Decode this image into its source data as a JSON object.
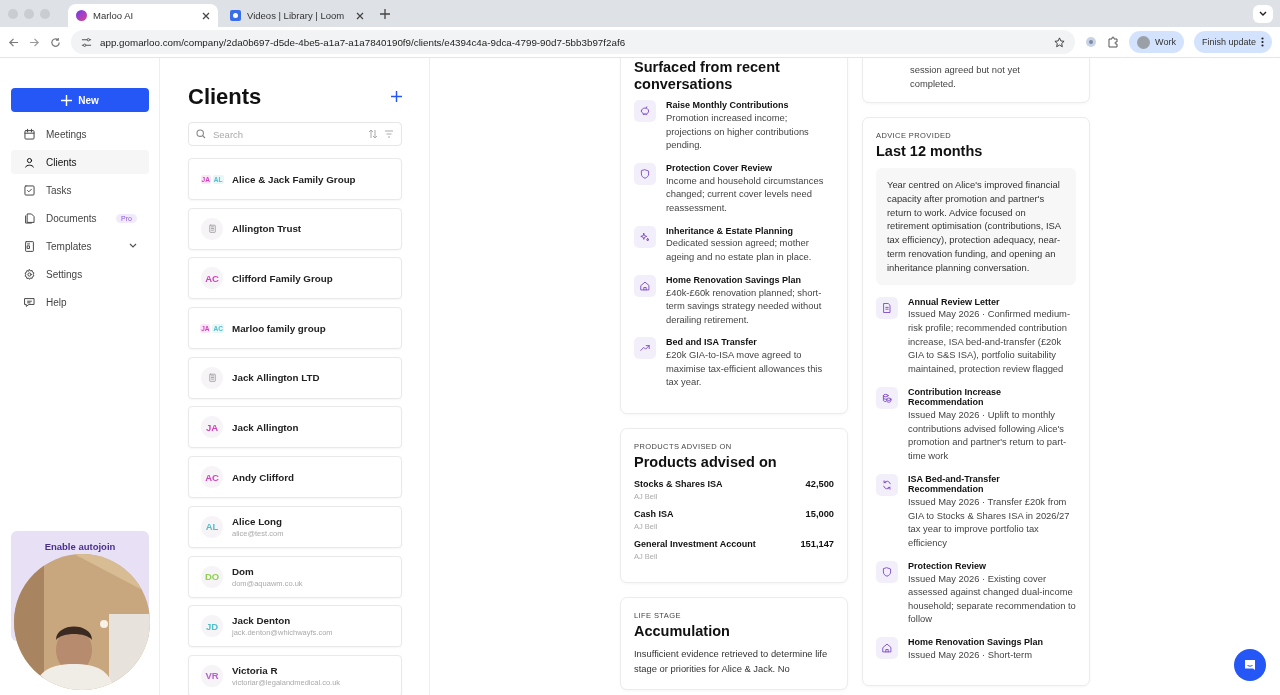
{
  "browser": {
    "tabs": [
      {
        "title": "Marloo AI",
        "selected": true
      },
      {
        "title": "Videos | Library | Loom",
        "selected": false
      }
    ],
    "url": "app.gomarloo.com/company/2da0b697-d5de-4be5-a1a7-a1a7840190f9/clients/e4394c4a-9dca-4799-90d7-5bb3b97f2af6",
    "profile": "Work",
    "update_button": "Finish update"
  },
  "sidebar": {
    "new_button": "New",
    "items": [
      {
        "label": "Meetings",
        "kind": "calendar",
        "selected": false
      },
      {
        "label": "Clients",
        "kind": "person",
        "selected": true
      },
      {
        "label": "Tasks",
        "kind": "check",
        "selected": false
      },
      {
        "label": "Documents",
        "kind": "docs",
        "selected": false,
        "badge": "Pro"
      },
      {
        "label": "Templates",
        "kind": "template",
        "selected": false,
        "expandable": true
      },
      {
        "label": "Settings",
        "kind": "gear",
        "selected": false
      },
      {
        "label": "Help",
        "kind": "chat",
        "selected": false
      }
    ],
    "promo": {
      "title": "Enable autojoin"
    }
  },
  "clients": {
    "title": "Clients",
    "search": {
      "placeholder": "Search"
    },
    "items": [
      {
        "name": "Alice & Jack Family Group",
        "kind": "group",
        "members": [
          "JA",
          "AL"
        ]
      },
      {
        "name": "Allington Trust",
        "kind": "entity"
      },
      {
        "name": "Clifford Family Group",
        "kind": "initials",
        "initials": "AC",
        "color": "#d23fbf"
      },
      {
        "name": "Marloo family group",
        "kind": "group",
        "members": [
          "JA",
          "AC"
        ]
      },
      {
        "name": "Jack Allington LTD",
        "kind": "entity"
      },
      {
        "name": "Jack Allington",
        "kind": "initials",
        "initials": "JA",
        "color": "#d23fbf"
      },
      {
        "name": "Andy Clifford",
        "kind": "initials",
        "initials": "AC",
        "color": "#d23fbf"
      },
      {
        "name": "Alice Long",
        "email": "alice@test.com",
        "kind": "initials",
        "initials": "AL",
        "color": "#4fbfc9"
      },
      {
        "name": "Dom",
        "email": "dom@aquawm.co.uk",
        "kind": "initials",
        "initials": "DO",
        "color": "#8fd14f"
      },
      {
        "name": "Jack Denton",
        "email": "jack.denton@whichwayfs.com",
        "kind": "initials",
        "initials": "JD",
        "color": "#4fbfc9"
      },
      {
        "name": "Victoria R",
        "email": "victoriar@legalandmedical.co.uk",
        "kind": "initials",
        "initials": "VR",
        "color": "#b65fd0"
      }
    ]
  },
  "surfaced": {
    "title": "Surfaced from recent conversations",
    "items": [
      {
        "title": "Raise Monthly Contributions",
        "text": "Promotion increased income; projections on higher contributions pending.",
        "kind": "piggy"
      },
      {
        "title": "Protection Cover Review",
        "text": "Income and household circumstances changed; current cover levels need reassessment.",
        "kind": "shield"
      },
      {
        "title": "Inheritance & Estate Planning",
        "text": "Dedicated session agreed; mother ageing and no estate plan in place.",
        "kind": "sparkle"
      },
      {
        "title": "Home Renovation Savings Plan",
        "text": "£40k-£60k renovation planned; short-term savings strategy needed without derailing retirement.",
        "kind": "home"
      },
      {
        "title": "Bed and ISA Transfer",
        "text": "£20k GIA-to-ISA move agreed to maximise tax-efficient allowances this tax year.",
        "kind": "trend"
      }
    ]
  },
  "products": {
    "eyebrow": "PRODUCTS ADVISED ON",
    "title": "Products advised on",
    "rows": [
      {
        "name": "Stocks & Shares ISA",
        "provider": "AJ Bell",
        "amount": "42,500"
      },
      {
        "name": "Cash ISA",
        "provider": "AJ Bell",
        "amount": "15,000"
      },
      {
        "name": "General Investment Account",
        "provider": "AJ Bell",
        "amount": "151,147"
      }
    ]
  },
  "life_stage": {
    "eyebrow": "LIFE STAGE",
    "title": "Accumulation",
    "text": "Insufficient evidence retrieved to determine life stage or priorities for Alice & Jack. No"
  },
  "previous_card": {
    "text": "session agreed but not yet completed."
  },
  "advice": {
    "eyebrow": "ADVICE PROVIDED",
    "title": "Last 12 months",
    "summary": "Year centred on Alice's improved financial capacity after promotion and partner's return to work. Advice focused on retirement optimisation (contributions, ISA tax efficiency), protection adequacy, near-term renovation funding, and opening an inheritance planning conversation.",
    "items": [
      {
        "title": "Annual Review Letter",
        "text": "Issued May 2026 · Confirmed medium-risk profile; recommended contribution increase, ISA bed-and-transfer (£20k GIA to S&S ISA), portfolio suitability maintained, protection review flagged",
        "kind": "doc"
      },
      {
        "title": "Contribution Increase Recommendation",
        "text": "Issued May 2026 · Uplift to monthly contributions advised following Alice's promotion and partner's return to part-time work",
        "kind": "coins"
      },
      {
        "title": "ISA Bed-and-Transfer Recommendation",
        "text": "Issued May 2026 · Transfer £20k from GIA to Stocks & Shares ISA in 2026/27 tax year to improve portfolio tax efficiency",
        "kind": "refresh"
      },
      {
        "title": "Protection Review",
        "text": "Issued May 2026 · Existing cover assessed against changed dual-income household; separate recommendation to follow",
        "kind": "shield"
      },
      {
        "title": "Home Renovation Savings Plan",
        "text": "Issued May 2026 · Short-term",
        "kind": "home"
      }
    ]
  }
}
